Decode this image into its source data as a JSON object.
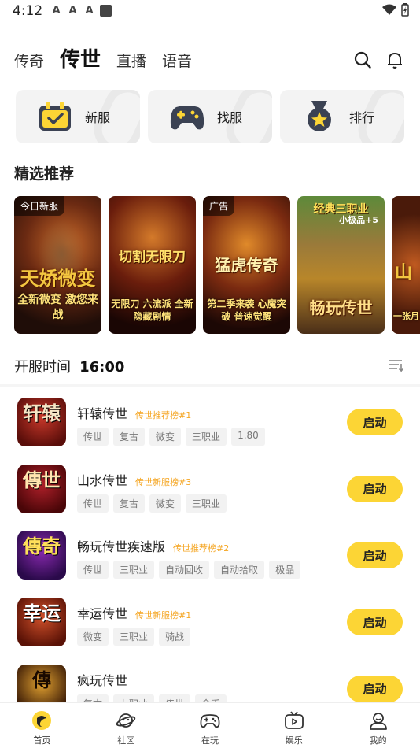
{
  "status_bar": {
    "time": "4:12",
    "notif_icons": [
      "A",
      "A",
      "A"
    ]
  },
  "top_tabs": [
    {
      "label": "传奇",
      "active": false
    },
    {
      "label": "传世",
      "active": true
    },
    {
      "label": "直播",
      "active": false
    },
    {
      "label": "语音",
      "active": false
    }
  ],
  "header_icons": [
    "search-icon",
    "bell-icon"
  ],
  "quick_cards": [
    {
      "label": "新服",
      "icon": "calendar-check-icon"
    },
    {
      "label": "找服",
      "icon": "gamepad-icon"
    },
    {
      "label": "排行",
      "icon": "medal-star-icon"
    }
  ],
  "featured": {
    "title": "精选推荐",
    "banners": [
      {
        "tag": "今日新服",
        "title": "天娇微变",
        "subtitle": "全新微变 激您来战",
        "top": "",
        "badge": ""
      },
      {
        "tag": "",
        "title": "切割无限刀",
        "subtitle": "无限刀 六流派 全新隐藏剧情",
        "top": "",
        "badge": ""
      },
      {
        "tag": "广告",
        "title": "猛虎传奇",
        "subtitle": "第二季来袭 心魔突破 普速觉醒",
        "top": "",
        "badge": ""
      },
      {
        "tag": "",
        "title": "畅玩传世",
        "subtitle": "",
        "top": "经典三职业",
        "badge": "小极品+5"
      },
      {
        "tag": "",
        "title": "山",
        "subtitle": "一张月",
        "top": "",
        "badge": ""
      }
    ]
  },
  "open_server": {
    "label": "开服时间",
    "time": "16:00"
  },
  "games": [
    {
      "name": "轩辕传世",
      "rank": "传世推荐榜#1",
      "tags": [
        "传世",
        "复古",
        "微变",
        "三职业",
        "1.80"
      ],
      "button": "启动",
      "icon_text": "轩辕"
    },
    {
      "name": "山水传世",
      "rank": "传世新服榜#3",
      "tags": [
        "传世",
        "复古",
        "微变",
        "三职业"
      ],
      "button": "启动",
      "icon_text": "傳世"
    },
    {
      "name": "畅玩传世疾速版",
      "rank": "传世推荐榜#2",
      "tags": [
        "传世",
        "三职业",
        "自动回收",
        "自动拾取",
        "极品"
      ],
      "button": "启动",
      "icon_text": "傳奇"
    },
    {
      "name": "幸运传世",
      "rank": "传世新服榜#1",
      "tags": [
        "微变",
        "三职业",
        "骑战"
      ],
      "button": "启动",
      "icon_text": "幸运"
    },
    {
      "name": "疯玩传世",
      "rank": "",
      "tags": [
        "复古",
        "九职业",
        "传世",
        "金币"
      ],
      "button": "启动",
      "icon_text": "傳"
    }
  ],
  "bottom_nav": [
    {
      "label": "首页",
      "icon": "home-logo-icon",
      "active": true
    },
    {
      "label": "社区",
      "icon": "planet-icon",
      "active": false
    },
    {
      "label": "在玩",
      "icon": "gamepad-icon",
      "active": false
    },
    {
      "label": "娱乐",
      "icon": "tv-icon",
      "active": false
    },
    {
      "label": "我的",
      "icon": "profile-icon",
      "active": false
    }
  ],
  "colors": {
    "accent": "#fcd535",
    "rank_text": "#f5a623",
    "tag_bg": "#f2f2f2"
  }
}
